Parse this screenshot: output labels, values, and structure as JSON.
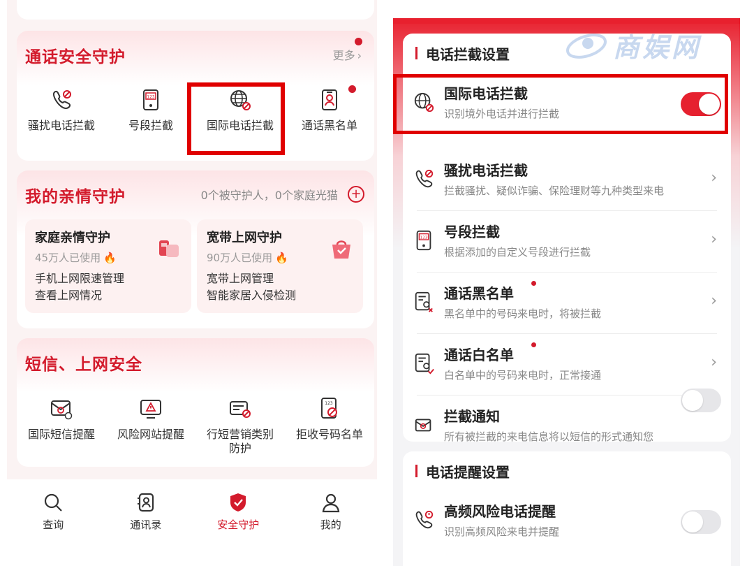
{
  "left": {
    "call_safety": {
      "title": "通话安全守护",
      "more": "更多",
      "items": [
        {
          "icon": "harassment-call-icon",
          "label": "骚扰电话拦截"
        },
        {
          "icon": "number-segment-icon",
          "label": "号段拦截"
        },
        {
          "icon": "globe-block-icon",
          "label": "国际电话拦截"
        },
        {
          "icon": "contact-card-icon",
          "label": "通话黑名单"
        }
      ]
    },
    "family": {
      "title": "我的亲情守护",
      "info": "0个被守护人，0个家庭光猫",
      "tiles": [
        {
          "title": "家庭亲情守护",
          "users": "45万人已使用",
          "desc1": "手机上网限速管理",
          "desc2": "查看上网情况"
        },
        {
          "title": "宽带上网守护",
          "users": "90万人已使用",
          "desc1": "宽带上网管理",
          "desc2": "智能家居入侵检测"
        }
      ]
    },
    "sms_web": {
      "title": "短信、上网安全",
      "items": [
        {
          "icon": "intl-sms-icon",
          "label": "国际短信提醒"
        },
        {
          "icon": "risk-site-icon",
          "label": "风险网站提醒"
        },
        {
          "icon": "marketing-sms-icon",
          "label": "行短营销类别防护"
        },
        {
          "icon": "reject-number-icon",
          "label": "拒收号码名单"
        }
      ]
    },
    "nav": [
      {
        "icon": "search-icon",
        "label": "查询"
      },
      {
        "icon": "contacts-icon",
        "label": "通讯录"
      },
      {
        "icon": "shield-icon",
        "label": "安全守护"
      },
      {
        "icon": "profile-icon",
        "label": "我的"
      }
    ]
  },
  "right": {
    "intercept_header": "电话拦截设置",
    "rows": [
      {
        "title": "国际电话拦截",
        "sub": "识别境外电话并进行拦截",
        "control": "toggle",
        "on": true
      },
      {
        "title": "骚扰电话拦截",
        "sub": "拦截骚扰、疑似诈骗、保险理财等九种类型来电",
        "control": "chevron"
      },
      {
        "title": "号段拦截",
        "sub": "根据添加的自定义号段进行拦截",
        "control": "chevron"
      },
      {
        "title": "通话黑名单",
        "sub": "黑名单中的号码来电时，将被拦截",
        "control": "chevron"
      },
      {
        "title": "通话白名单",
        "sub": "白名单中的号码来电时，正常接通",
        "control": "chevron"
      },
      {
        "title": "拦截通知",
        "sub": "所有被拦截的来电信息将以短信的形式通知您",
        "control": "toggle",
        "on": false
      }
    ],
    "reminder_header": "电话提醒设置",
    "reminder_rows": [
      {
        "title": "高频风险电话提醒",
        "sub": "识别高频风险来电并提醒",
        "control": "toggle",
        "on": false
      }
    ]
  },
  "watermark": "商娱网",
  "colors": {
    "brand": "#d31b2c",
    "toggle_on": "#e6212f",
    "highlight": "#e00000"
  }
}
